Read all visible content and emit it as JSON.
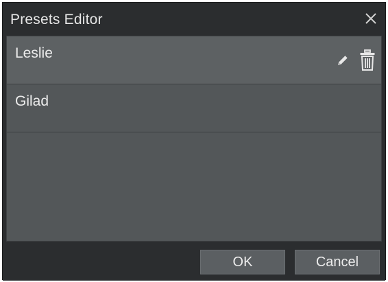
{
  "dialog": {
    "title": "Presets Editor",
    "close_icon": "close-icon"
  },
  "presets": [
    {
      "label": "Leslie",
      "selected": true,
      "actions": [
        "pencil-icon",
        "trash-icon"
      ]
    },
    {
      "label": "Gilad",
      "selected": false
    }
  ],
  "footer": {
    "ok_label": "OK",
    "cancel_label": "Cancel"
  },
  "colors": {
    "dialog_bg": "#2b2d2f",
    "list_bg": "#535759",
    "selected_row_bg": "#5d6163",
    "button_bg": "#5b5f62",
    "text": "#ececec"
  }
}
